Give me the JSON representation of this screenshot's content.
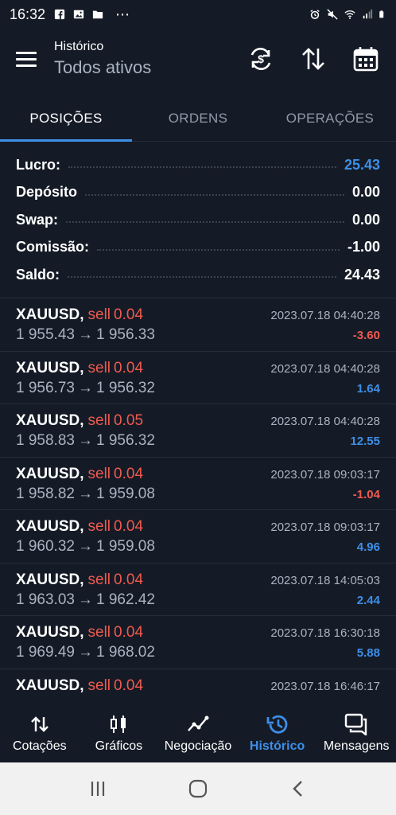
{
  "status_bar": {
    "time": "16:32",
    "more": "⋯"
  },
  "header": {
    "subtitle": "Histórico",
    "title": "Todos ativos",
    "icons": [
      "menu-icon",
      "currency-sync-icon",
      "sort-icon",
      "calendar-icon"
    ]
  },
  "tabs": [
    {
      "label": "POSIÇÕES",
      "active": true
    },
    {
      "label": "ORDENS",
      "active": false
    },
    {
      "label": "OPERAÇÕES",
      "active": false
    }
  ],
  "summary": [
    {
      "label": "Lucro:",
      "value": "25.43",
      "color": "#3d8fe8"
    },
    {
      "label": "Depósito",
      "value": "0.00",
      "color": "#ffffff"
    },
    {
      "label": "Swap:",
      "value": "0.00",
      "color": "#ffffff"
    },
    {
      "label": "Comissão:",
      "value": "-1.00",
      "color": "#ffffff"
    },
    {
      "label": "Saldo:",
      "value": "24.43",
      "color": "#ffffff"
    }
  ],
  "positions": [
    {
      "symbol": "XAUUSD,",
      "side": "sell",
      "volume": "0.04",
      "date": "2023.07.18 04:40:28",
      "open": "1 955.43",
      "close": "1 956.33",
      "profit": "-3.60",
      "positive": false
    },
    {
      "symbol": "XAUUSD,",
      "side": "sell",
      "volume": "0.04",
      "date": "2023.07.18 04:40:28",
      "open": "1 956.73",
      "close": "1 956.32",
      "profit": "1.64",
      "positive": true
    },
    {
      "symbol": "XAUUSD,",
      "side": "sell",
      "volume": "0.05",
      "date": "2023.07.18 04:40:28",
      "open": "1 958.83",
      "close": "1 956.32",
      "profit": "12.55",
      "positive": true
    },
    {
      "symbol": "XAUUSD,",
      "side": "sell",
      "volume": "0.04",
      "date": "2023.07.18 09:03:17",
      "open": "1 958.82",
      "close": "1 959.08",
      "profit": "-1.04",
      "positive": false
    },
    {
      "symbol": "XAUUSD,",
      "side": "sell",
      "volume": "0.04",
      "date": "2023.07.18 09:03:17",
      "open": "1 960.32",
      "close": "1 959.08",
      "profit": "4.96",
      "positive": true
    },
    {
      "symbol": "XAUUSD,",
      "side": "sell",
      "volume": "0.04",
      "date": "2023.07.18 14:05:03",
      "open": "1 963.03",
      "close": "1 962.42",
      "profit": "2.44",
      "positive": true
    },
    {
      "symbol": "XAUUSD,",
      "side": "sell",
      "volume": "0.04",
      "date": "2023.07.18 16:30:18",
      "open": "1 969.49",
      "close": "1 968.02",
      "profit": "5.88",
      "positive": true
    },
    {
      "symbol": "XAUUSD,",
      "side": "sell",
      "volume": "0.04",
      "date": "2023.07.18 16:46:17",
      "open": "",
      "close": "",
      "profit": "",
      "positive": true
    }
  ],
  "arrow_glyph": "→",
  "bottom_nav": [
    {
      "label": "Cotações",
      "icon": "quotes-icon",
      "active": false
    },
    {
      "label": "Gráficos",
      "icon": "charts-icon",
      "active": false
    },
    {
      "label": "Negociação",
      "icon": "trade-icon",
      "active": false
    },
    {
      "label": "Histórico",
      "icon": "history-icon",
      "active": true
    },
    {
      "label": "Mensagens",
      "icon": "messages-icon",
      "active": false
    }
  ],
  "colors": {
    "background": "#151b26",
    "accent": "#3d8fe8",
    "sell": "#f05a4f",
    "muted": "#a9b3c1"
  }
}
